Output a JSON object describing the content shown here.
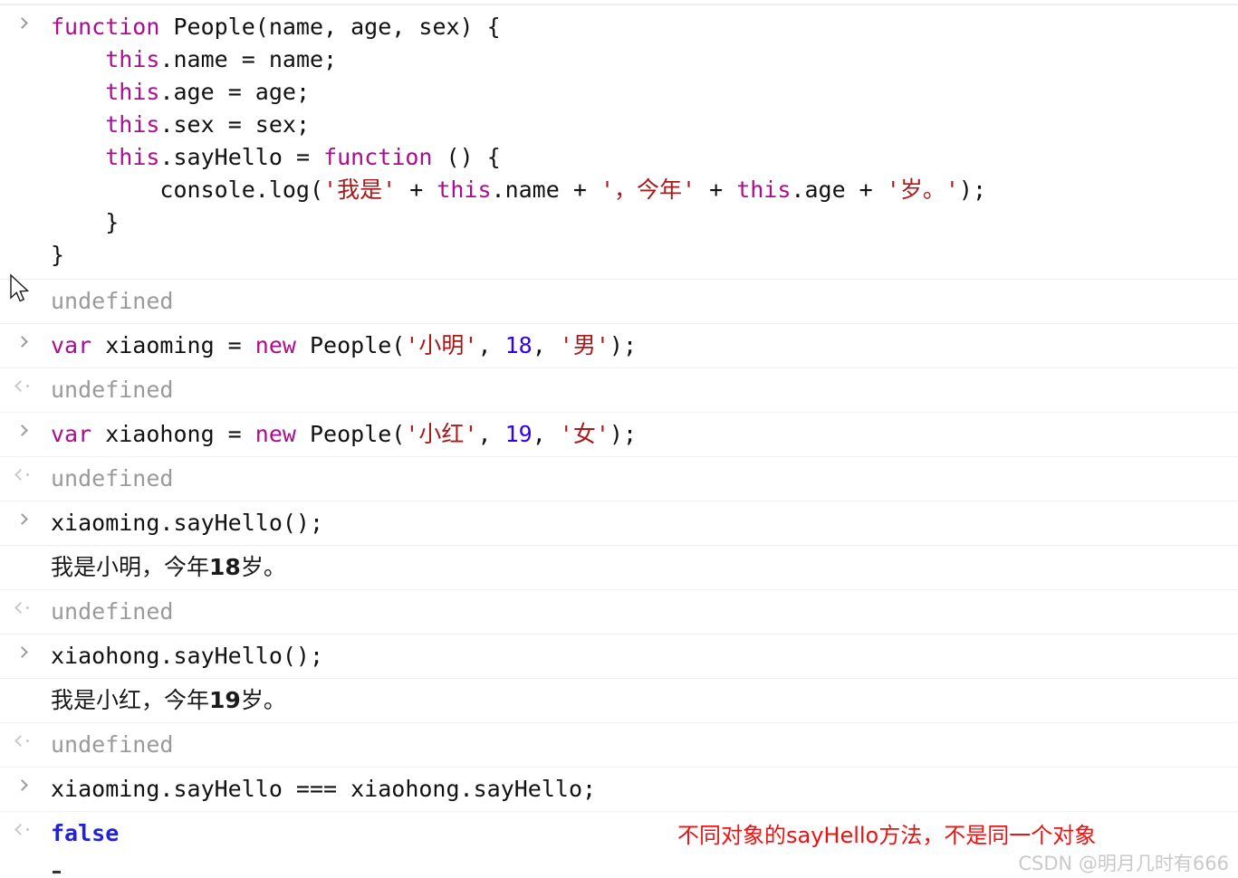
{
  "app": {
    "name": "Browser DevTools Console",
    "background": "#ffffff",
    "rule_color": "#f0f0f0"
  },
  "icons": {
    "input_prompt": "chevron-right-icon",
    "output_prompt": "chevron-left-dot-icon",
    "mouse": "mouse-arrow-cursor"
  },
  "colors": {
    "keyword": "#aa0d91",
    "string": "#a91919",
    "number": "#3300ee",
    "undefined": "#9a9a9a",
    "boolean": "#2121d6",
    "annotation": "#ee1111",
    "watermark": "#c9c9c9",
    "plain": "#111111"
  },
  "entries": [
    {
      "kind": "input",
      "marker": ">",
      "code_lines": [
        [
          {
            "t": "function ",
            "c": "kw"
          },
          {
            "t": "People(name, age, sex) {",
            "c": "plain"
          }
        ],
        [
          {
            "t": "    ",
            "c": "plain"
          },
          {
            "t": "this",
            "c": "kw"
          },
          {
            "t": ".name = name;",
            "c": "plain"
          }
        ],
        [
          {
            "t": "    ",
            "c": "plain"
          },
          {
            "t": "this",
            "c": "kw"
          },
          {
            "t": ".age = age;",
            "c": "plain"
          }
        ],
        [
          {
            "t": "    ",
            "c": "plain"
          },
          {
            "t": "this",
            "c": "kw"
          },
          {
            "t": ".sex = sex;",
            "c": "plain"
          }
        ],
        [
          {
            "t": "    ",
            "c": "plain"
          },
          {
            "t": "this",
            "c": "kw"
          },
          {
            "t": ".sayHello = ",
            "c": "plain"
          },
          {
            "t": "function",
            "c": "kw"
          },
          {
            "t": " () {",
            "c": "plain"
          }
        ],
        [
          {
            "t": "        console.log(",
            "c": "plain"
          },
          {
            "t": "'我是'",
            "c": "str"
          },
          {
            "t": " + ",
            "c": "plain"
          },
          {
            "t": "this",
            "c": "kw"
          },
          {
            "t": ".name + ",
            "c": "plain"
          },
          {
            "t": "'，今年'",
            "c": "str"
          },
          {
            "t": " + ",
            "c": "plain"
          },
          {
            "t": "this",
            "c": "kw"
          },
          {
            "t": ".age + ",
            "c": "plain"
          },
          {
            "t": "'岁。'",
            "c": "str"
          },
          {
            "t": ");",
            "c": "plain"
          }
        ],
        [
          {
            "t": "    }",
            "c": "plain"
          }
        ],
        [
          {
            "t": "}",
            "c": "plain"
          }
        ]
      ]
    },
    {
      "kind": "result",
      "marker": "",
      "code_lines": [
        [
          {
            "t": "undefined",
            "c": "undef"
          }
        ]
      ],
      "no_marker": true
    },
    {
      "kind": "input",
      "marker": ">",
      "code_lines": [
        [
          {
            "t": "var",
            "c": "kw"
          },
          {
            "t": " xiaoming = ",
            "c": "plain"
          },
          {
            "t": "new",
            "c": "kw"
          },
          {
            "t": " People(",
            "c": "plain"
          },
          {
            "t": "'小明'",
            "c": "str"
          },
          {
            "t": ", ",
            "c": "plain"
          },
          {
            "t": "18",
            "c": "num"
          },
          {
            "t": ", ",
            "c": "plain"
          },
          {
            "t": "'男'",
            "c": "str"
          },
          {
            "t": ");",
            "c": "plain"
          }
        ]
      ]
    },
    {
      "kind": "result",
      "marker": "<",
      "code_lines": [
        [
          {
            "t": "undefined",
            "c": "undef"
          }
        ]
      ]
    },
    {
      "kind": "input",
      "marker": ">",
      "code_lines": [
        [
          {
            "t": "var",
            "c": "kw"
          },
          {
            "t": " xiaohong = ",
            "c": "plain"
          },
          {
            "t": "new",
            "c": "kw"
          },
          {
            "t": " People(",
            "c": "plain"
          },
          {
            "t": "'小红'",
            "c": "str"
          },
          {
            "t": ", ",
            "c": "plain"
          },
          {
            "t": "19",
            "c": "num"
          },
          {
            "t": ", ",
            "c": "plain"
          },
          {
            "t": "'女'",
            "c": "str"
          },
          {
            "t": ");",
            "c": "plain"
          }
        ]
      ]
    },
    {
      "kind": "result",
      "marker": "<",
      "code_lines": [
        [
          {
            "t": "undefined",
            "c": "undef"
          }
        ]
      ]
    },
    {
      "kind": "input",
      "marker": ">",
      "code_lines": [
        [
          {
            "t": "xiaoming.sayHello();",
            "c": "plain"
          }
        ]
      ]
    },
    {
      "kind": "log",
      "marker": "",
      "no_marker": true,
      "log_text": "我是小明，今年18岁。"
    },
    {
      "kind": "result",
      "marker": "<",
      "code_lines": [
        [
          {
            "t": "undefined",
            "c": "undef"
          }
        ]
      ]
    },
    {
      "kind": "input",
      "marker": ">",
      "code_lines": [
        [
          {
            "t": "xiaohong.sayHello();",
            "c": "plain"
          }
        ]
      ]
    },
    {
      "kind": "log",
      "marker": "",
      "no_marker": true,
      "log_text": "我是小红，今年19岁。"
    },
    {
      "kind": "result",
      "marker": "<",
      "code_lines": [
        [
          {
            "t": "undefined",
            "c": "undef"
          }
        ]
      ]
    },
    {
      "kind": "input",
      "marker": ">",
      "code_lines": [
        [
          {
            "t": "xiaoming.sayHello === xiaohong.sayHello;",
            "c": "plain"
          }
        ]
      ]
    },
    {
      "kind": "result",
      "marker": "<",
      "code_lines": [
        [
          {
            "t": "false",
            "c": "bool"
          }
        ]
      ]
    }
  ],
  "annotation": {
    "text": "不同对象的sayHello方法，不是同一个对象"
  },
  "watermark": {
    "text": "CSDN @明月几时有666"
  }
}
